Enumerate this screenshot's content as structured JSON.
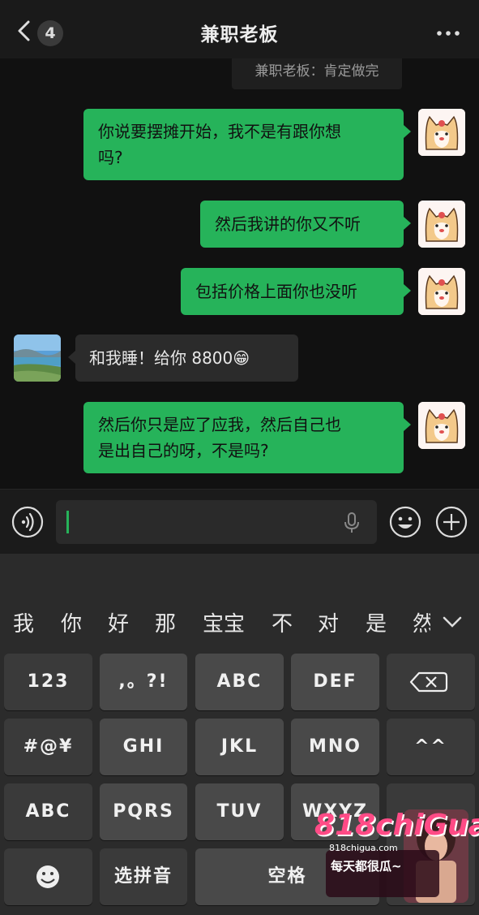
{
  "header": {
    "back_count": "4",
    "title": "兼职老板"
  },
  "chat": {
    "quote": "兼职老板：肯定做完",
    "messages": [
      {
        "side": "right",
        "lines": [
          "你说要摆摊开始，我不是有跟你想",
          "吗?"
        ]
      },
      {
        "side": "right",
        "lines": [
          "然后我讲的你又不听"
        ]
      },
      {
        "side": "right",
        "lines": [
          "包括价格上面你也没听"
        ]
      },
      {
        "side": "left",
        "lines": [
          "和我睡！给你 8800😁"
        ]
      },
      {
        "side": "right",
        "lines": [
          "然后你只是应了应我，然后自己也",
          "是出自己的呀，不是吗?"
        ]
      }
    ]
  },
  "keyboard": {
    "candidates": [
      "我",
      "你",
      "好",
      "那",
      "宝宝",
      "不",
      "对",
      "是",
      "然"
    ],
    "rows": [
      [
        "123",
        ",。?!",
        "ABC",
        "DEF",
        "⌫"
      ],
      [
        "#@¥",
        "GHI",
        "JKL",
        "MNO",
        "^^"
      ],
      [
        "ABC",
        "PQRS",
        "TUV",
        "WXYZ",
        ""
      ],
      [
        "☺",
        "选拼音",
        "空格",
        ""
      ]
    ]
  },
  "watermark": {
    "logo": "818chiGua",
    "site": "818chigua.com",
    "slogan": "每天都很瓜~"
  },
  "colors": {
    "bubble_green": "#26b35a",
    "bubble_gray": "#2b2b2b",
    "background": "#111111"
  }
}
